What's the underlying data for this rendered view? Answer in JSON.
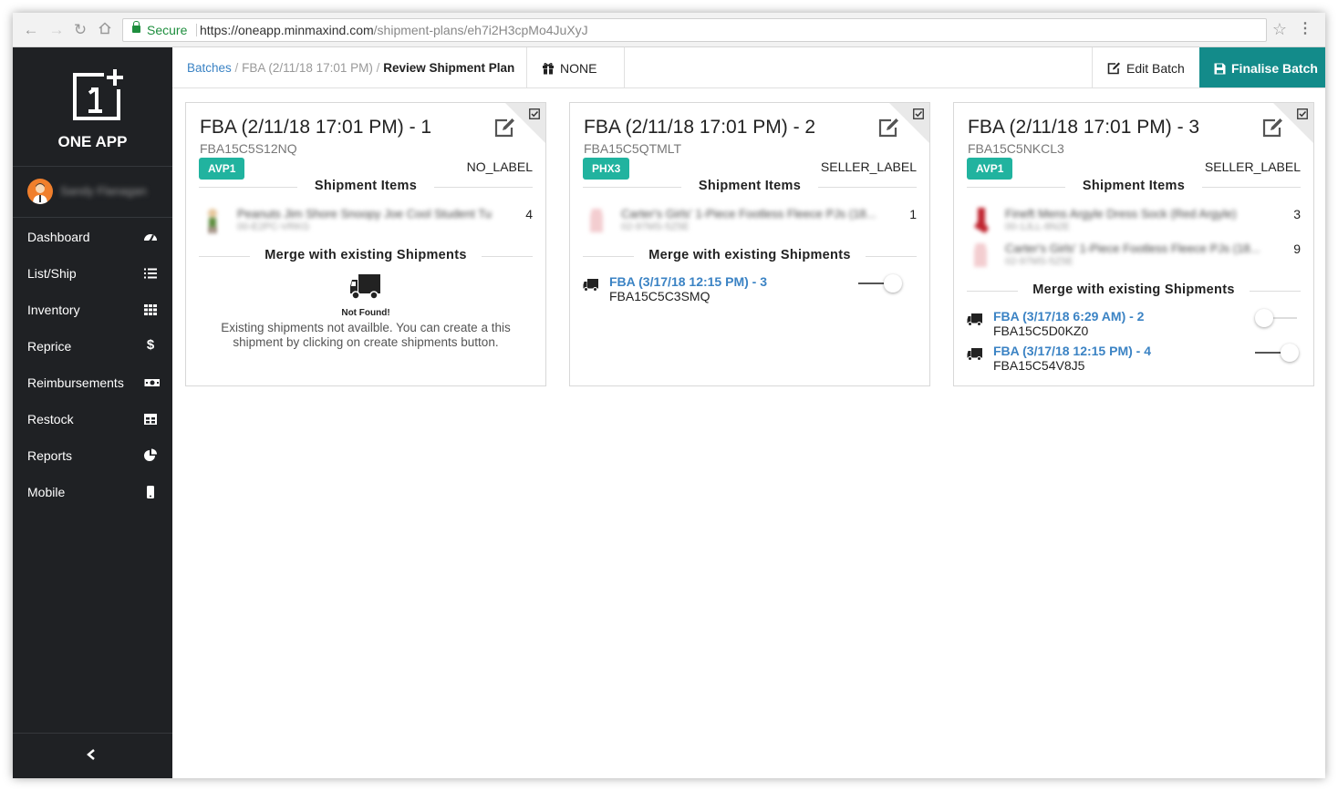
{
  "browser": {
    "secure_label": "Secure",
    "url_host": "https://oneapp.minmaxind.com",
    "url_path": "/shipment-plans/eh7i2H3cpMo4JuXyJ"
  },
  "sidebar": {
    "app_name": "ONE APP",
    "user_name": "Sandy Flanagan",
    "items": [
      {
        "label": "Dashboard",
        "icon": "dashboard-icon"
      },
      {
        "label": "List/Ship",
        "icon": "list-icon"
      },
      {
        "label": "Inventory",
        "icon": "grid-icon"
      },
      {
        "label": "Reprice",
        "icon": "dollar-icon"
      },
      {
        "label": "Reimbursements",
        "icon": "money-icon"
      },
      {
        "label": "Restock",
        "icon": "table-icon"
      },
      {
        "label": "Reports",
        "icon": "pie-chart-icon"
      },
      {
        "label": "Mobile",
        "icon": "mobile-icon"
      }
    ]
  },
  "header": {
    "crumb_batches": "Batches",
    "crumb_sep": "/",
    "crumb_batch": "FBA (2/11/18 17:01 PM)",
    "crumb_current": "Review Shipment Plan",
    "none_label": "NONE",
    "edit_batch": "Edit Batch",
    "finalise_batch": "Finalise Batch"
  },
  "colors": {
    "accent": "#138b8a",
    "badge": "#21b39f",
    "link": "#3b83c4",
    "sidebar_bg": "#1f2124"
  },
  "cards": [
    {
      "title": "FBA (2/11/18 17:01 PM) - 1",
      "code": "FBA15C5S12NQ",
      "badge": "AVP1",
      "label_type": "NO_LABEL",
      "items_title": "Shipment Items",
      "items": [
        {
          "name": "Peanuts Jim Shore Snoopy Joe Cool Student Tu",
          "sku": "00-E2PC-VRKG",
          "qty": "4"
        }
      ],
      "merge_title": "Merge with existing Shipments",
      "not_found": "Not Found!",
      "empty_msg": "Existing shipments not availble. You can create a this shipment by clicking on create shipments button."
    },
    {
      "title": "FBA (2/11/18 17:01 PM) - 2",
      "code": "FBA15C5QTMLT",
      "badge": "PHX3",
      "label_type": "SELLER_LABEL",
      "items_title": "Shipment Items",
      "items": [
        {
          "name": "Carter's Girls' 1-Piece Footless Fleece PJs (18...",
          "sku": "02-97MS-5Z5E",
          "qty": "1"
        }
      ],
      "merge_title": "Merge with existing Shipments",
      "shipments": [
        {
          "link": "FBA (3/17/18 12:15 PM) - 3",
          "code": "FBA15C5C3SMQ",
          "toggle": "on"
        }
      ]
    },
    {
      "title": "FBA (2/11/18 17:01 PM) - 3",
      "code": "FBA15C5NKCL3",
      "badge": "AVP1",
      "label_type": "SELLER_LABEL",
      "items_title": "Shipment Items",
      "items": [
        {
          "name": "Fineft Mens Argyle Dress Sock (Red Argyle)",
          "sku": "00-1JLL-8N2E",
          "qty": "3"
        },
        {
          "name": "Carter's Girls' 1-Piece Footless Fleece PJs (18...",
          "sku": "02-97MS-5Z5E",
          "qty": "9"
        }
      ],
      "merge_title": "Merge with existing Shipments",
      "shipments": [
        {
          "link": "FBA (3/17/18 6:29 AM) - 2",
          "code": "FBA15C5D0KZ0",
          "toggle": "off"
        },
        {
          "link": "FBA (3/17/18 12:15 PM) - 4",
          "code": "FBA15C54V8J5",
          "toggle": "on"
        }
      ]
    }
  ]
}
